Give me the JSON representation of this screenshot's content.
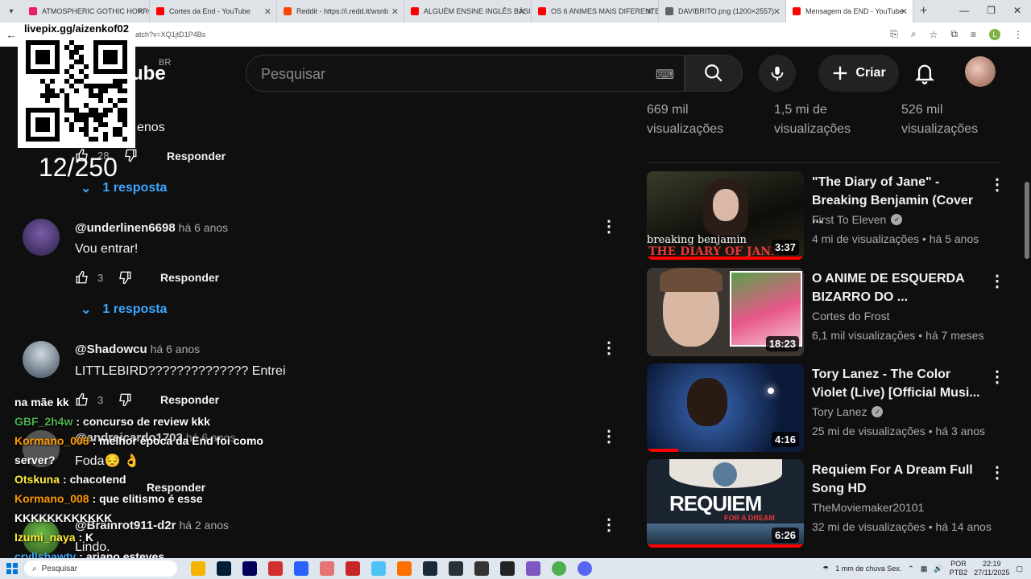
{
  "browser": {
    "tabs": [
      {
        "title": "ATMOSPHERIC GOTHIC HORRO",
        "color": "#e91e63"
      },
      {
        "title": "Cortes da End - YouTube",
        "color": "#ff0000"
      },
      {
        "title": "Reddit - https://i.redd.it/wsnb",
        "color": "#ff4500"
      },
      {
        "title": "ALGUÉM ENSINE INGLÊS BÁSIC",
        "color": "#ff0000"
      },
      {
        "title": "OS 6 ANIMES MAIS DIFERENTE",
        "color": "#ff0000"
      },
      {
        "title": "DAVIBRITO.png (1200×2557)",
        "color": "#5f6368"
      },
      {
        "title": "Mensagem da END - YouTube",
        "color": "#ff0000",
        "active": true
      }
    ],
    "url": "atch?v=XQ1jtD1P4Bs"
  },
  "header": {
    "logo_text": "ube",
    "logo_region": "BR",
    "search_placeholder": "Pesquisar",
    "create_label": "Criar"
  },
  "comments": [
    {
      "handle": "",
      "when": "",
      "text": "enos",
      "likes": "28",
      "reply_label": "Responder",
      "replies": "1 resposta"
    },
    {
      "handle": "@underlinen6698",
      "when": "há 6 anos",
      "text": "Vou entrar!",
      "likes": "3",
      "reply_label": "Responder",
      "replies": "1 resposta"
    },
    {
      "handle": "@Shadowcu",
      "when": "há 6 anos",
      "text": "LITTLEBIRD?????????????? Entrei",
      "likes": "3",
      "reply_label": "Responder"
    },
    {
      "handle": "@andreicardo1703",
      "when": "há 6 anos",
      "text": "Foda😔 👌",
      "likes": "",
      "reply_label": "Responder"
    },
    {
      "handle": "@Brainrot911-d2r",
      "when": "há 2 anos",
      "text": "Lindo."
    }
  ],
  "sidebar": {
    "top_views": [
      "669 mil visualizações",
      "1,5 mi de visualizações",
      "526 mil visualizações"
    ],
    "videos": [
      {
        "title": "\"The Diary of Jane\" - Breaking Benjamin (Cover ...",
        "channel": "First To Eleven",
        "verified": true,
        "views": "4 mi de visualizações",
        "age": "há 5 anos",
        "duration": "3:37",
        "thumb_text": "breaking benjamin",
        "thumb_text2": "THE DIARY OF JANE",
        "progress": 1.0
      },
      {
        "title": "O ANIME DE ESQUERDA BIZARRO DO ...",
        "channel": "Cortes do Frost",
        "verified": false,
        "views": "6,1 mil visualizações",
        "age": "há 7 meses",
        "duration": "18:23",
        "progress": 0
      },
      {
        "title": "Tory Lanez - The Color Violet (Live) [Official Musi...",
        "channel": "Tory Lanez",
        "verified": true,
        "views": "25 mi de visualizações",
        "age": "há 3 anos",
        "duration": "4:16",
        "progress": 0.2
      },
      {
        "title": "Requiem For A Dream Full Song HD",
        "channel": "TheMoviemaker20101",
        "verified": false,
        "views": "32 mi de visualizações",
        "age": "há 14 anos",
        "duration": "6:26",
        "thumb_text": "REQUIEM",
        "thumb_text2": "FOR A DREAM",
        "progress": 1.0
      }
    ]
  },
  "overlay": {
    "qr_caption": "livepix.gg/aizenkof02",
    "counter": "12/250",
    "chat": [
      {
        "user": "",
        "msg": "na mãe kk",
        "color": "#ffffff"
      },
      {
        "user": "GBF_2h4w",
        "msg": ": concurso de review kkk",
        "color": "#4caf50"
      },
      {
        "user": "Kormano_008",
        "msg": ": melhor época da End foi como server?",
        "color": "#ff9800"
      },
      {
        "user": "Otskuna",
        "msg": ": chacotend",
        "color": "#ffeb3b"
      },
      {
        "user": "Kormano_008",
        "msg": ": que elitismo é esse KKKKKKKKKKKK",
        "color": "#ff9800"
      },
      {
        "user": "Izumi_naya",
        "msg": ": K",
        "color": "#ffeb3b"
      },
      {
        "user": "cryllshawty",
        "msg": ": ariano esteves",
        "color": "#42a5f5"
      }
    ]
  },
  "taskbar": {
    "search_label": "Pesquisar",
    "weather": "1 mm de chuva Sex.",
    "lang": "POR",
    "lang2": "PTB2",
    "time": "22:19",
    "date": "27/11/2025"
  }
}
